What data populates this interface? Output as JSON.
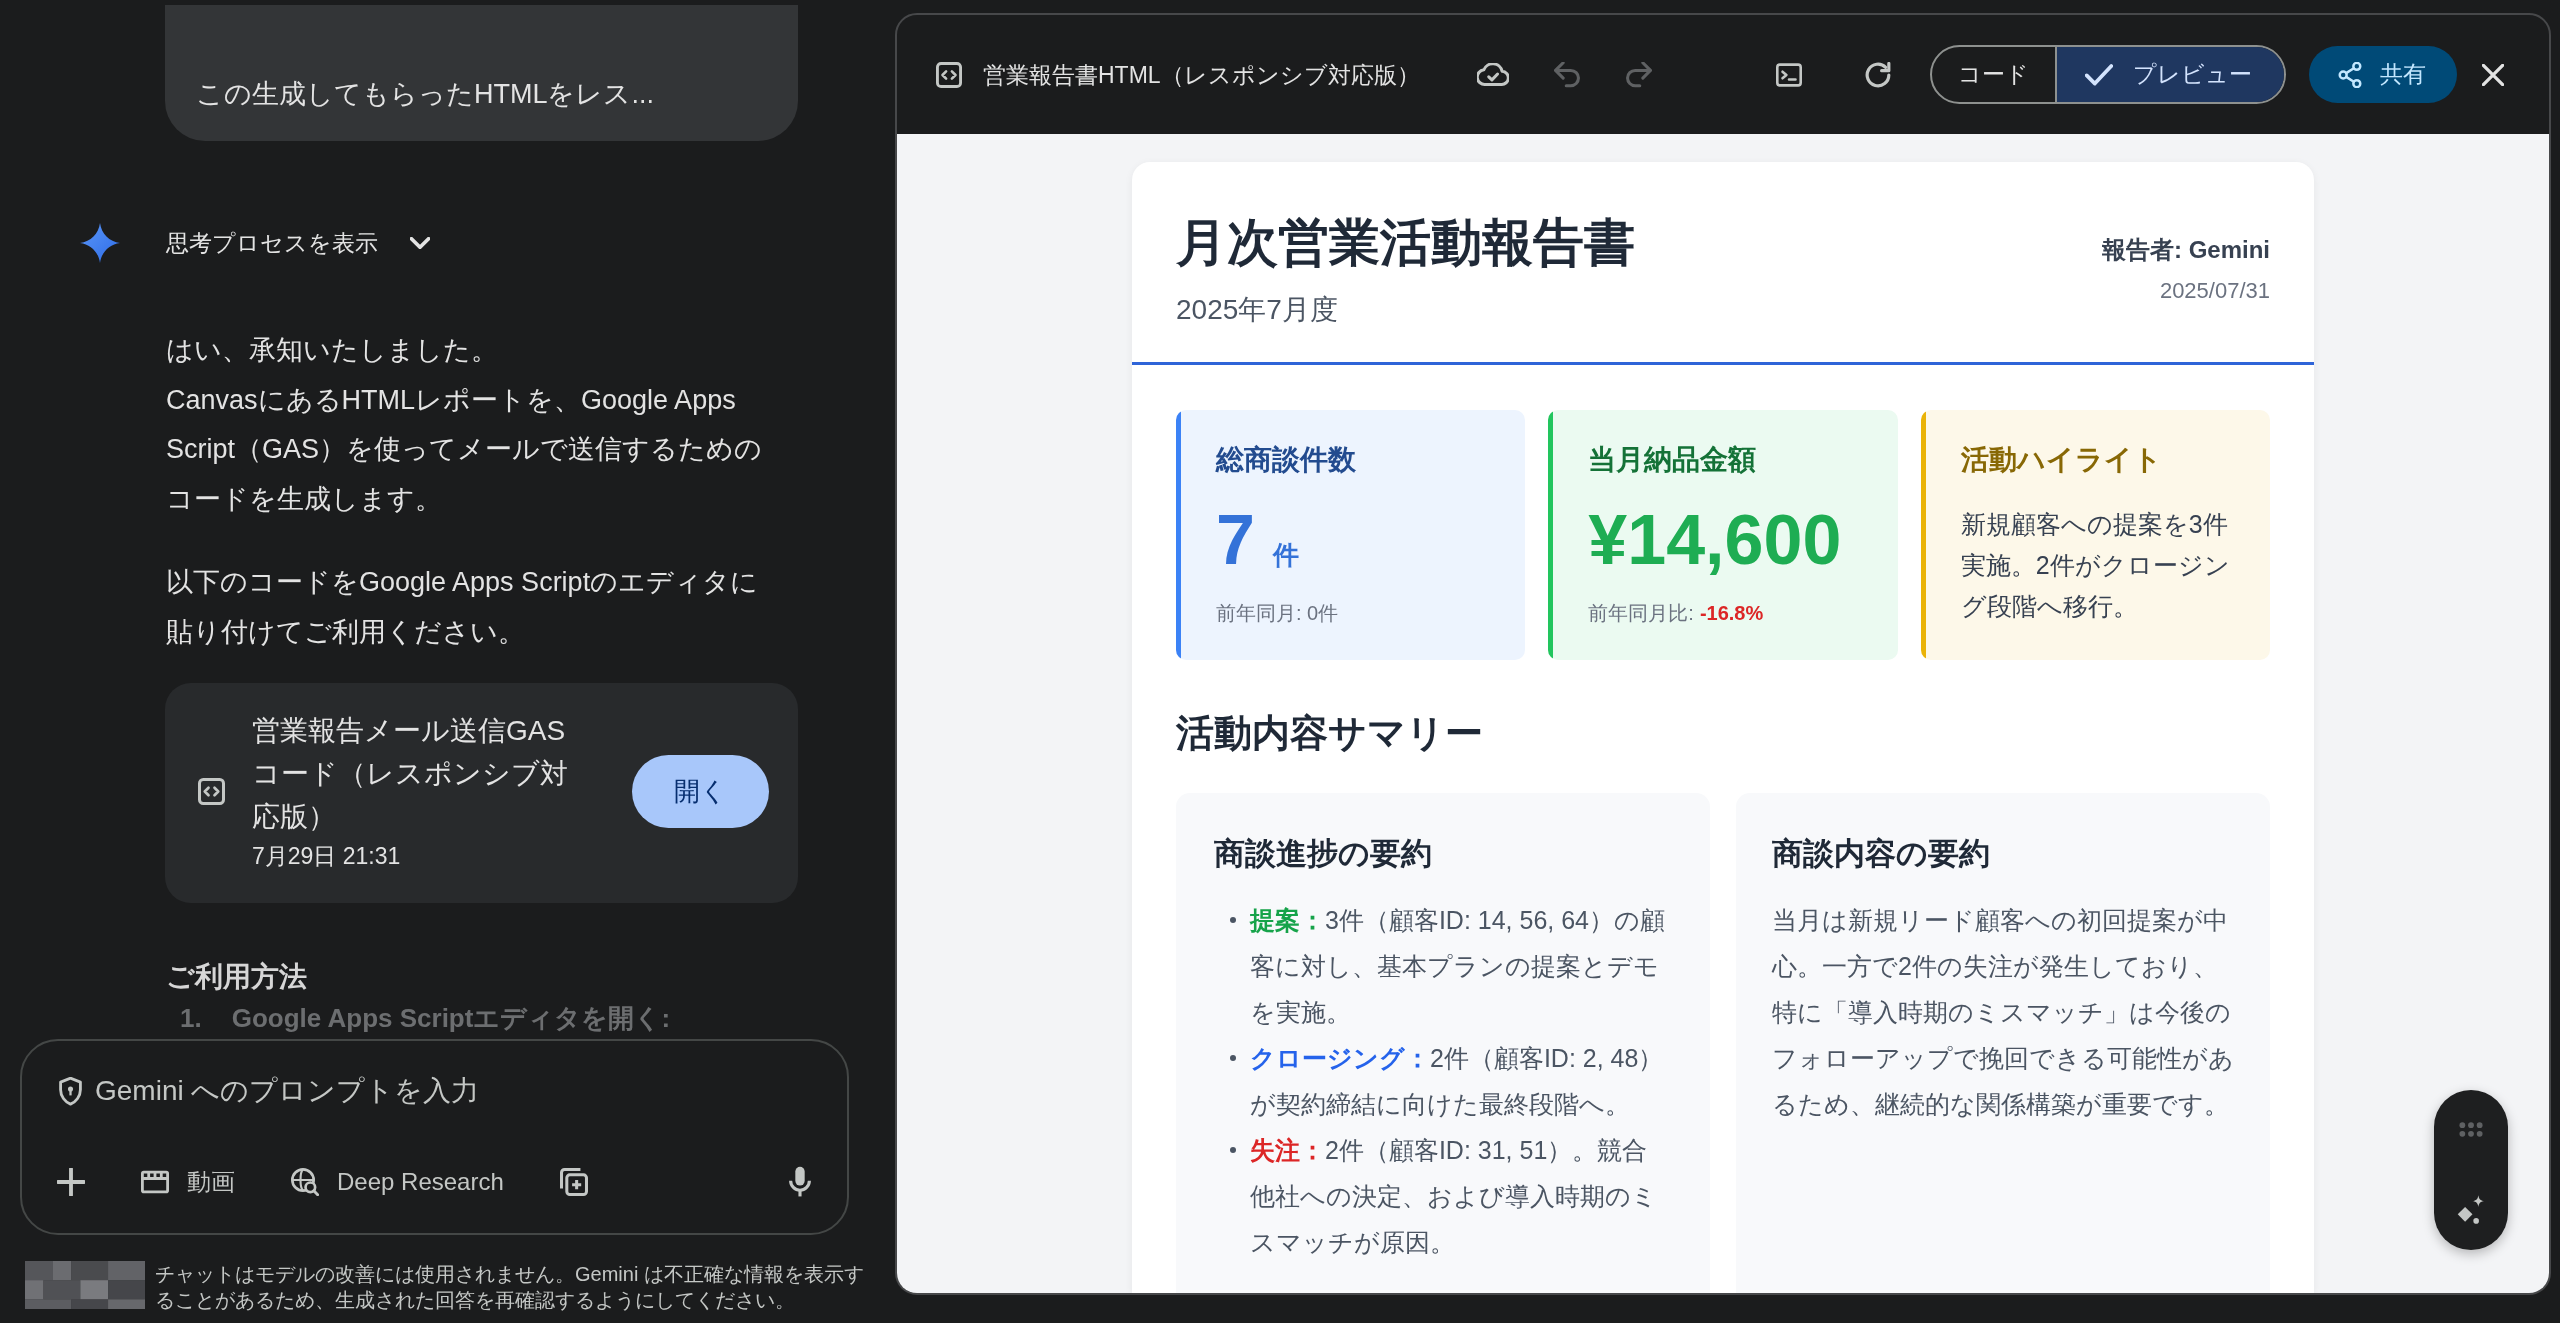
{
  "chat": {
    "user_message": "この生成してもらったHTMLをレス...",
    "thinking_toggle": {
      "label": "思考プロセスを表示",
      "expanded": false
    },
    "paragraphs": [
      "はい、承知いたしました。\nCanvasにあるHTMLレポートを、Google Apps Script（GAS）を使ってメールで送信するためのコードを生成します。",
      "以下のコードをGoogle Apps Scriptのエディタに貼り付けてご利用ください。"
    ],
    "artifact_card": {
      "title": "営業報告メール送信GASコード（レスポンシブ対応版）",
      "timestamp": "7月29日 21:31",
      "button": "開く"
    },
    "section_heading": "ご利用方法",
    "steps": [
      {
        "number": "1.",
        "text": "Google Apps Scriptエディタを開く:"
      }
    ]
  },
  "prompt_box": {
    "placeholder": "Gemini へのプロンプトを入力",
    "tools": [
      {
        "kind": "add"
      },
      {
        "kind": "video",
        "label": "動画"
      },
      {
        "kind": "deep_research",
        "label": "Deep Research"
      },
      {
        "kind": "canvas"
      },
      {
        "kind": "mic"
      }
    ]
  },
  "disclaimer": "チャットはモデルの改善には使用されません。Gemini は不正確な情報を表示することがあるため、生成された回答を再確認するようにしてください。",
  "preview": {
    "title": "営業報告書HTML（レスポンシブ対応版）",
    "undo": {
      "disabled": true
    },
    "redo": {
      "disabled": true
    },
    "view_toggle": [
      {
        "label": "コード",
        "selected": false
      },
      {
        "label": "プレビュー",
        "selected": true
      }
    ],
    "share_button": "共有",
    "report": {
      "title": "月次営業活動報告書",
      "period": "2025年7月度",
      "reporter": "報告者: Gemini",
      "date": "2025/07/31",
      "kpis": [
        {
          "kind": "count",
          "title": "総商談件数",
          "value": "7",
          "unit": "件",
          "note": "前年同月: 0件",
          "color": "#3b82f6"
        },
        {
          "kind": "amount",
          "title": "当月納品金額",
          "value": "¥14,600",
          "note": "前年同月比:",
          "change": "-16.8%",
          "color": "#22c55e"
        },
        {
          "kind": "text",
          "title": "活動ハイライト",
          "text": "新規顧客への提案を3件実施。2件がクロージング段階へ移行。",
          "color": "#eab308"
        }
      ],
      "summary_heading": "活動内容サマリー",
      "summary_cards": [
        {
          "kind": "list",
          "title": "商談進捗の要約",
          "items": [
            {
              "label": "提案：",
              "text": "3件（顧客ID: 14, 56, 64）の顧客に対し、基本プランの提案とデモを実施。",
              "color": "#16a34a"
            },
            {
              "label": "クロージング：",
              "text": "2件（顧客ID: 2, 48）が契約締結に向けた最終段階へ。",
              "color": "#2563eb"
            },
            {
              "label": "失注：",
              "text": "2件（顧客ID: 31, 51）。競合他社への決定、および導入時期のミスマッチが原因。",
              "color": "#dc2626"
            }
          ]
        },
        {
          "kind": "paragraph",
          "title": "商談内容の要約",
          "text": "当月は新規リード顧客への初回提案が中心。一方で2件の失注が発生しており、特に「導入時期のミスマッチ」は今後のフォローアップで挽回できる可能性があるため、継続的な関係構築が重要です。"
        }
      ]
    }
  }
}
